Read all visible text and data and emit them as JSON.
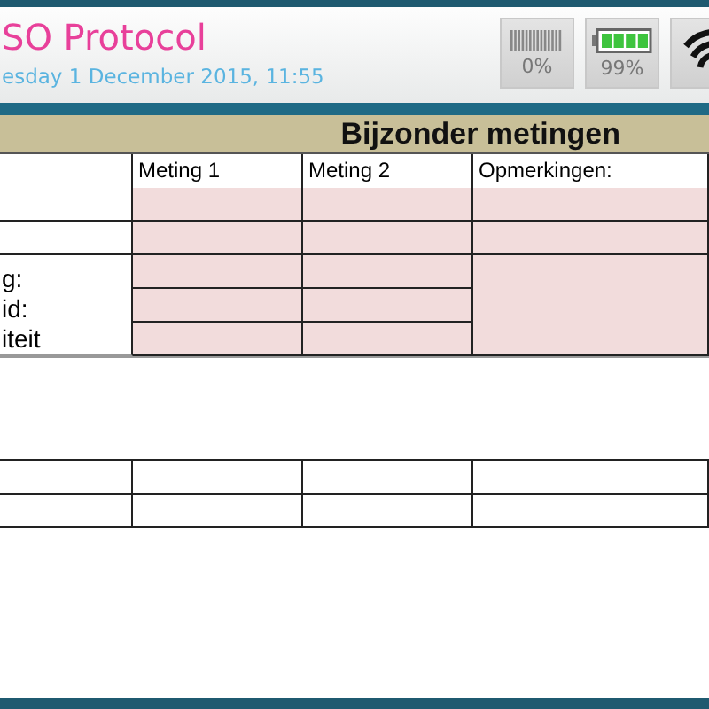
{
  "header": {
    "title": "SO Protocol",
    "datetime": "esday 1 December 2015, 11:55"
  },
  "status": [
    {
      "kind": "signal",
      "reading": "0%"
    },
    {
      "kind": "battery",
      "reading": "99%"
    },
    {
      "kind": "wifi"
    }
  ],
  "table": {
    "title": "Bijzonder metingen",
    "columns": [
      "Meting 1",
      "Meting 2",
      "Opmerkingen:"
    ],
    "rows": [
      {
        "kind": "pink"
      },
      {
        "kind": "pink"
      },
      {
        "kind": "group",
        "labels": [
          "g:",
          "id:",
          "iteit"
        ]
      }
    ],
    "extra_rows": [
      {
        "kind": "plain"
      },
      {
        "kind": "plain"
      }
    ]
  }
}
